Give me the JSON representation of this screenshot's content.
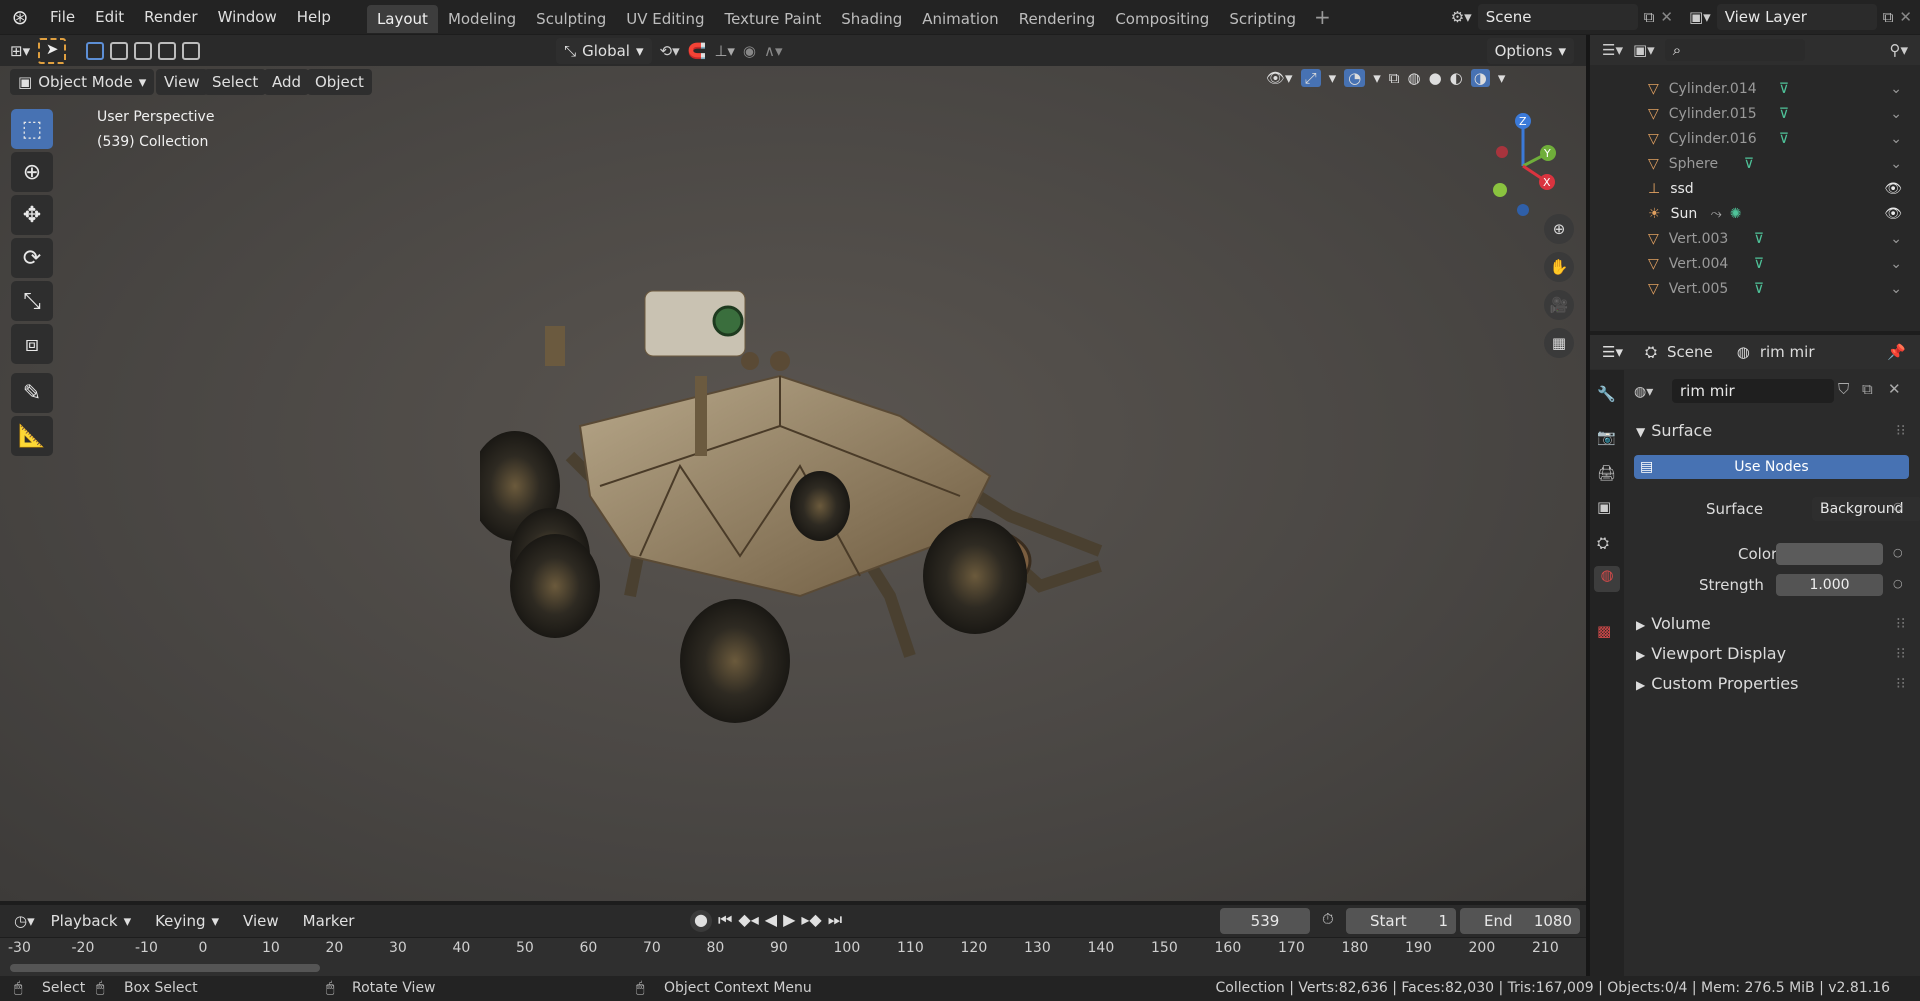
{
  "menu": {
    "file": "File",
    "edit": "Edit",
    "render": "Render",
    "window": "Window",
    "help": "Help"
  },
  "workspaces": [
    "Layout",
    "Modeling",
    "Sculpting",
    "UV Editing",
    "Texture Paint",
    "Shading",
    "Animation",
    "Rendering",
    "Compositing",
    "Scripting"
  ],
  "scene": {
    "name": "Scene",
    "view_layer": "View Layer"
  },
  "toolbar": {
    "orientation": "Global",
    "options": "Options",
    "mode": "Object Mode",
    "view": "View",
    "select": "Select",
    "add": "Add",
    "object": "Object"
  },
  "viewport": {
    "perspective": "User Perspective",
    "collection": "(539) Collection",
    "gizmo_z": "Z",
    "gizmo_y": "Y",
    "gizmo_x": "X"
  },
  "outliner": {
    "items": [
      {
        "name": "Cylinder.014"
      },
      {
        "name": "Cylinder.015"
      },
      {
        "name": "Cylinder.016"
      },
      {
        "name": "Sphere"
      },
      {
        "name": "ssd"
      },
      {
        "name": "Sun"
      },
      {
        "name": "Vert.003"
      },
      {
        "name": "Vert.004"
      },
      {
        "name": "Vert.005"
      }
    ]
  },
  "properties": {
    "scene_label": "Scene",
    "world_label": "rim mir",
    "world_field": "rim mir",
    "surface_panel": "Surface",
    "use_nodes": "Use Nodes",
    "surface_label": "Surface",
    "surface_value": "Background",
    "color_label": "Color",
    "strength_label": "Strength",
    "strength_value": "1.000",
    "volume": "Volume",
    "viewport_display": "Viewport Display",
    "custom_properties": "Custom Properties"
  },
  "timeline": {
    "playback": "Playback",
    "keying": "Keying",
    "view": "View",
    "marker": "Marker",
    "current_frame": "539",
    "start_label": "Start",
    "start_value": "1",
    "end_label": "End",
    "end_value": "1080",
    "ticks": [
      "-30",
      "-20",
      "-10",
      "0",
      "10",
      "20",
      "30",
      "40",
      "50",
      "60",
      "70",
      "80",
      "90",
      "100",
      "110",
      "120",
      "130",
      "140",
      "150",
      "160",
      "170",
      "180",
      "190",
      "200",
      "210"
    ]
  },
  "status": {
    "select": "Select",
    "box_select": "Box Select",
    "rotate_view": "Rotate View",
    "context_menu": "Object Context Menu",
    "stats": "Collection | Verts:82,636 | Faces:82,030 | Tris:167,009 | Objects:0/4 | Mem: 276.5 MiB | v2.81.16"
  }
}
